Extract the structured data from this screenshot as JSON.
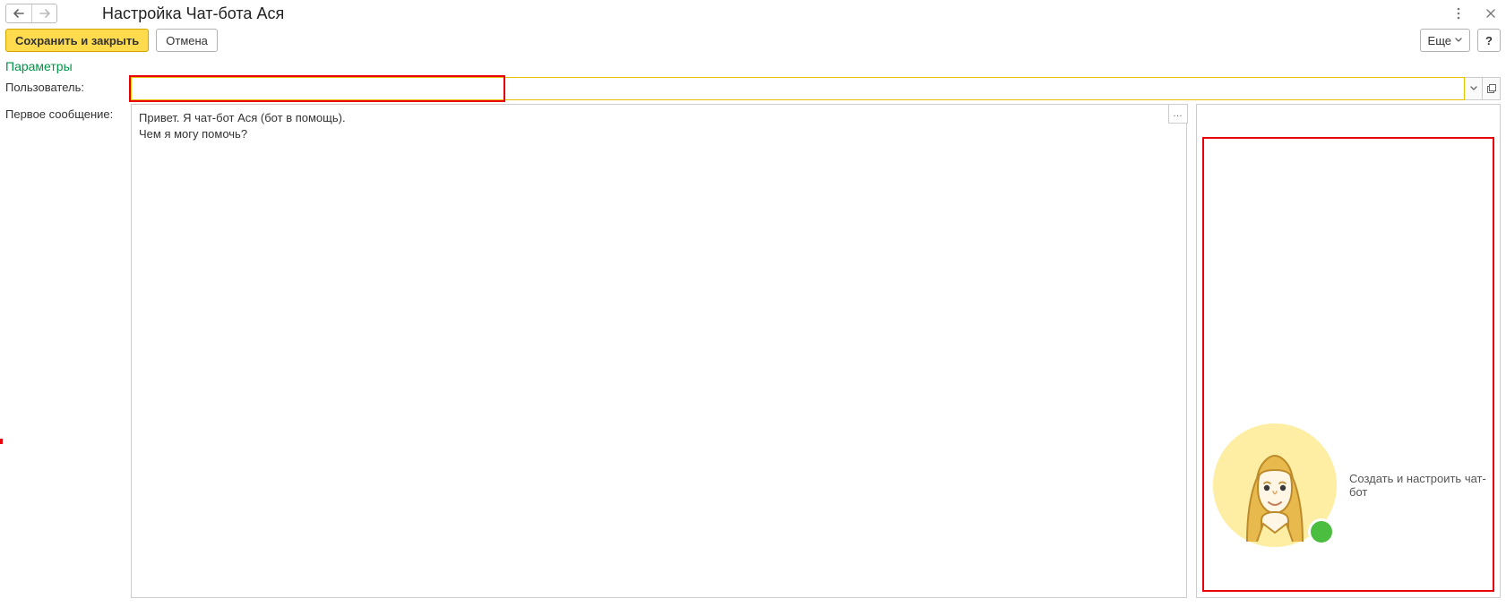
{
  "window": {
    "title": "Настройка Чат-бота Ася"
  },
  "toolbar": {
    "save_and_close": "Сохранить и закрыть",
    "cancel": "Отмена",
    "more": "Еще",
    "help": "?"
  },
  "section": {
    "parameters": "Параметры"
  },
  "fields": {
    "user_label": "Пользователь:",
    "user_value": "",
    "first_message_label": "Первое сообщение:",
    "first_message_value": "Привет. Я чат-бот Ася (бот в помощь).\nЧем я могу помочь?"
  },
  "preview": {
    "avatar_caption": "Создать и настроить чат-бот",
    "status_color": "#4bbd3f"
  }
}
